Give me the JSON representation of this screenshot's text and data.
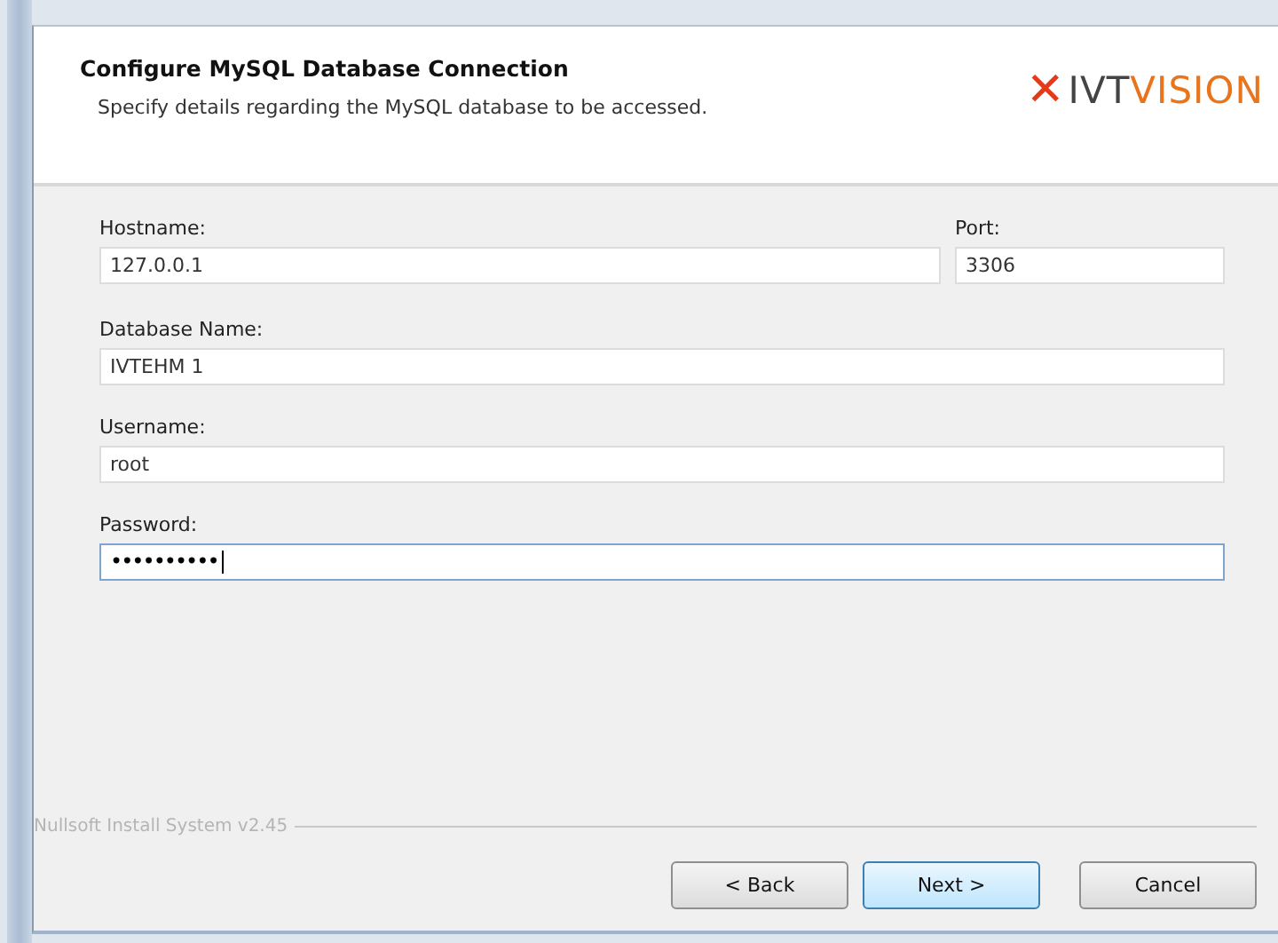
{
  "header": {
    "title": "Configure MySQL Database Connection",
    "subtitle": "Specify details regarding the MySQL database to be accessed.",
    "logo": {
      "mark": "✕",
      "text_dark": "IVT",
      "text_accent": "VISION"
    }
  },
  "fields": {
    "hostname": {
      "label": "Hostname:",
      "value": "127.0.0.1",
      "focused": false
    },
    "port": {
      "label": "Port:",
      "value": "3306",
      "focused": false
    },
    "database": {
      "label": "Database Name:",
      "value": "IVTEHM 1",
      "focused": false
    },
    "username": {
      "label": "Username:",
      "value": "root",
      "focused": false
    },
    "password": {
      "label": "Password:",
      "value": "••••••••••",
      "focused": true
    }
  },
  "branding": "Nullsoft Install System v2.45",
  "buttons": [
    {
      "label": "< Back",
      "default": false
    },
    {
      "label": "Next >",
      "default": true
    },
    {
      "label": "Cancel",
      "default": false
    }
  ]
}
